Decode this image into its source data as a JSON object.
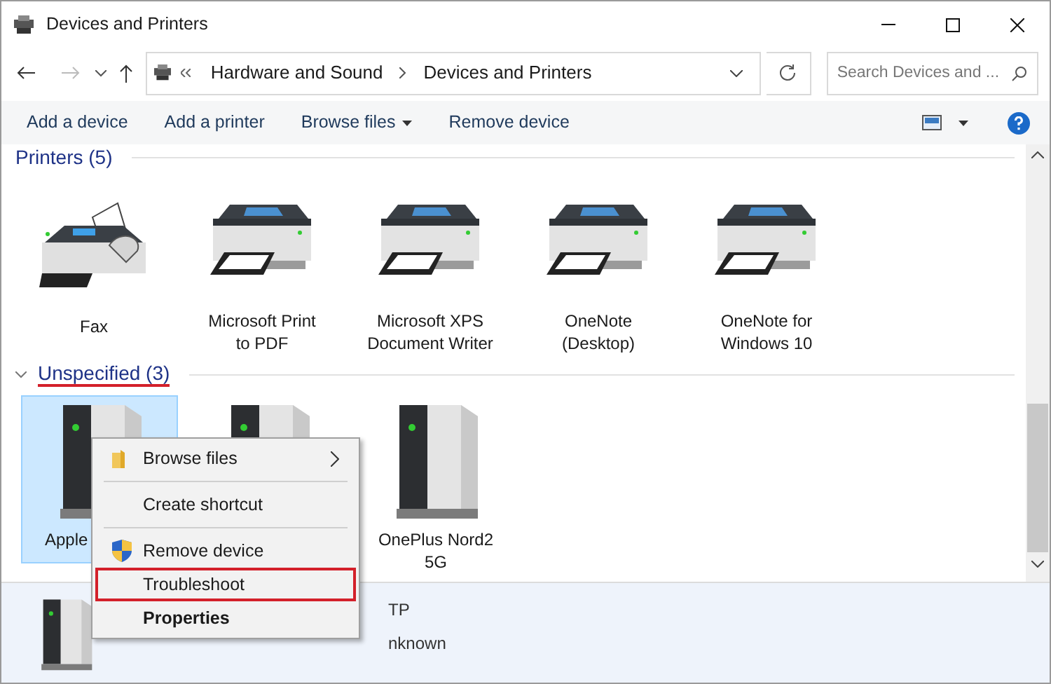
{
  "window": {
    "title": "Devices and Printers"
  },
  "address": {
    "crumbs": [
      "Hardware and Sound",
      "Devices and Printers"
    ]
  },
  "search": {
    "placeholder": "Search Devices and ..."
  },
  "commands": [
    {
      "label": "Add a device",
      "dropdown": false
    },
    {
      "label": "Add a printer",
      "dropdown": false
    },
    {
      "label": "Browse files",
      "dropdown": true
    },
    {
      "label": "Remove device",
      "dropdown": false
    }
  ],
  "sections": [
    {
      "title": "Printers (5)",
      "underlined": false,
      "devices": [
        {
          "kind": "fax",
          "label": "Fax",
          "selected": false
        },
        {
          "kind": "printer",
          "label": "Microsoft Print to PDF",
          "selected": false
        },
        {
          "kind": "printer",
          "label": "Microsoft XPS Document Writer",
          "selected": false
        },
        {
          "kind": "printer",
          "label": "OneNote (Desktop)",
          "selected": false
        },
        {
          "kind": "printer",
          "label": "OneNote for Windows 10",
          "selected": false
        }
      ]
    },
    {
      "title": "Unspecified (3)",
      "underlined": true,
      "devices": [
        {
          "kind": "tower",
          "label": "Apple",
          "selected": true
        },
        {
          "kind": "tower",
          "selected": false
        },
        {
          "kind": "tower",
          "label": "OnePlus Nord2 5G",
          "selected": false
        }
      ]
    }
  ],
  "context_menu": [
    {
      "kind": "folder",
      "label": "Browse files",
      "submenu": true,
      "bold": false,
      "outlined": false
    },
    {
      "kind": "separator"
    },
    {
      "kind": "plain",
      "label": "Create shortcut",
      "submenu": false,
      "bold": false,
      "outlined": false
    },
    {
      "kind": "separator"
    },
    {
      "kind": "shield",
      "label": "Remove device",
      "submenu": false,
      "bold": false,
      "outlined": false
    },
    {
      "kind": "plain",
      "label": "Troubleshoot",
      "submenu": false,
      "bold": false,
      "outlined": true
    },
    {
      "kind": "plain",
      "label": "Properties",
      "submenu": false,
      "bold": true,
      "outlined": false
    }
  ],
  "details": {
    "name": "TP",
    "category": "nknown"
  }
}
